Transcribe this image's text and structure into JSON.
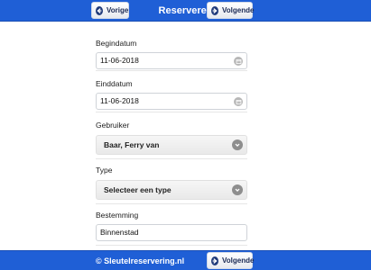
{
  "header": {
    "title": "Reserveren",
    "prev_label": "Vorige",
    "next_label": "Volgende"
  },
  "form": {
    "begindatum": {
      "label": "Begindatum",
      "value": "11-06-2018",
      "icon": "calendar-icon"
    },
    "einddatum": {
      "label": "Einddatum",
      "value": "11-06-2018",
      "icon": "calendar-icon"
    },
    "gebruiker": {
      "label": "Gebruiker",
      "value": "Baar, Ferry van",
      "icon": "chevron-down-icon"
    },
    "type": {
      "label": "Type",
      "value": "Selecteer een type",
      "icon": "chevron-down-icon"
    },
    "bestemming": {
      "label": "Bestemming",
      "value": "Binnenstad"
    }
  },
  "footer": {
    "copyright": "© Sleutelreservering.nl",
    "next_label": "Volgende"
  },
  "colors": {
    "bar": "#1f5fd6",
    "button_icon": "#1f3a7a"
  }
}
